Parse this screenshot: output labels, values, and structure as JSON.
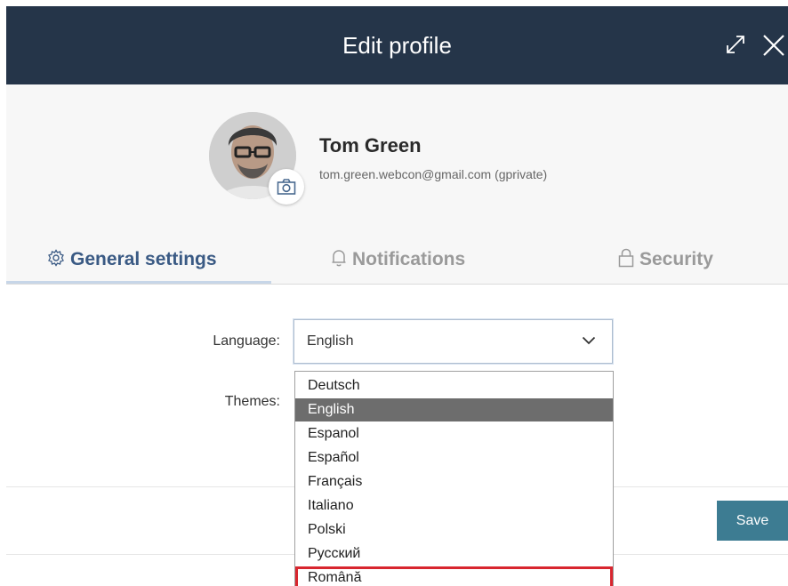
{
  "dialog": {
    "title": "Edit profile",
    "icons": {
      "expand": "expand-icon",
      "close": "close-icon"
    }
  },
  "profile": {
    "name": "Tom Green",
    "email": "tom.green.webcon@gmail.com (gprivate)",
    "camera_icon": "camera-icon"
  },
  "tabs": [
    {
      "label": "General settings",
      "icon": "gear-icon",
      "active": true
    },
    {
      "label": "Notifications",
      "icon": "bell-icon",
      "active": false
    },
    {
      "label": "Security",
      "icon": "lock-icon",
      "active": false
    }
  ],
  "form": {
    "language_label": "Language:",
    "language_value": "English",
    "themes_label": "Themes:"
  },
  "language_options": [
    "Deutsch",
    "English",
    "Espanol",
    "Español",
    "Français",
    "Italiano",
    "Polski",
    "Русский",
    "Română"
  ],
  "selected_option": "English",
  "highlighted_option": "Română",
  "footer": {
    "save_label": "Save"
  },
  "colors": {
    "titlebar": "#253549",
    "active_tab": "#3a5a84",
    "save_button": "#3d7c92",
    "highlight_outline": "#d8262f",
    "selected_option_bg": "#6d6d6d"
  }
}
